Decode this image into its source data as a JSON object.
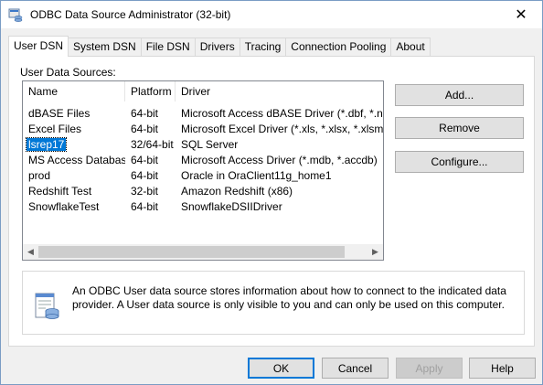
{
  "window": {
    "title": "ODBC Data Source Administrator (32-bit)",
    "close_glyph": "✕"
  },
  "tabs": [
    {
      "label": "User DSN",
      "active": true
    },
    {
      "label": "System DSN"
    },
    {
      "label": "File DSN"
    },
    {
      "label": "Drivers"
    },
    {
      "label": "Tracing"
    },
    {
      "label": "Connection Pooling"
    },
    {
      "label": "About"
    }
  ],
  "user_dsn": {
    "section_label": "User Data Sources:",
    "columns": {
      "name": "Name",
      "platform": "Platform",
      "driver": "Driver"
    },
    "rows": [
      {
        "name": "dBASE Files",
        "platform": "64-bit",
        "driver": "Microsoft Access dBASE Driver (*.dbf, *.ndx, *.m"
      },
      {
        "name": "Excel Files",
        "platform": "64-bit",
        "driver": "Microsoft Excel Driver (*.xls, *.xlsx, *.xlsm, *.xlsb"
      },
      {
        "name": "lsrep17",
        "platform": "32/64-bit",
        "driver": "SQL Server",
        "selected": true
      },
      {
        "name": "MS Access Database",
        "platform": "64-bit",
        "driver": "Microsoft Access Driver (*.mdb, *.accdb)"
      },
      {
        "name": "prod",
        "platform": "64-bit",
        "driver": "Oracle in OraClient11g_home1"
      },
      {
        "name": "Redshift Test",
        "platform": "32-bit",
        "driver": "Amazon Redshift (x86)"
      },
      {
        "name": "SnowflakeTest",
        "platform": "64-bit",
        "driver": "SnowflakeDSIIDriver"
      }
    ],
    "buttons": {
      "add": "Add...",
      "remove": "Remove",
      "configure": "Configure..."
    },
    "info_text": "An ODBC User data source stores information about how to connect to the indicated data provider.   A User data source is only visible to you and can only be used on this computer."
  },
  "footer": {
    "ok": "OK",
    "cancel": "Cancel",
    "apply": "Apply",
    "help": "Help"
  },
  "colors": {
    "selection": "#0078d7",
    "default_button_border": "#0078d7"
  }
}
